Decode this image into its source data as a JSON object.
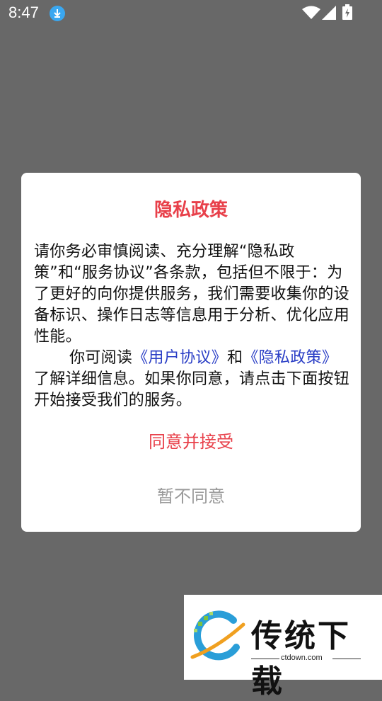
{
  "status_bar": {
    "time": "8:47",
    "icons": [
      "download-icon",
      "wifi-icon",
      "signal-icon",
      "battery-icon"
    ]
  },
  "dialog": {
    "title": "隐私政策",
    "paragraph1": "请你务必审慎阅读、充分理解“隐私政策”和“服务协议”各条款，包括但不限于：为了更好的向你提供服务，我们需要收集你的设备标识、操作日志等信息用于分析、优化应用性能。",
    "paragraph2_prefix": "你可阅读",
    "user_agreement_link": "《用户协议》",
    "paragraph2_and": "和",
    "privacy_policy_link": "《隐私政策》",
    "paragraph2_suffix": "了解详细信息。如果你同意，请点击下面按钮开始接受我们的服务。",
    "agree_label": "同意并接受",
    "disagree_label": "暂不同意"
  },
  "watermark": {
    "name": "传统下载",
    "domain": "ctdown.com"
  },
  "colors": {
    "overlay": "#686868",
    "accent_red": "#e8404a",
    "link_blue": "#2b3fc6",
    "muted_gray": "#9a9a9a"
  }
}
